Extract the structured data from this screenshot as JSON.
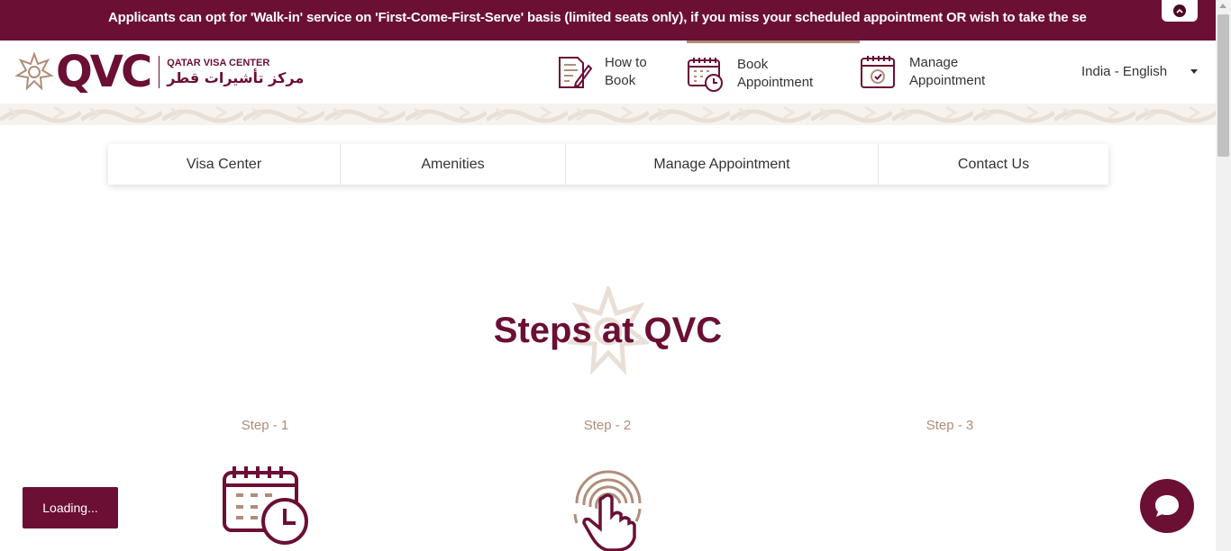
{
  "announcement": {
    "text": "Applicants can opt for 'Walk-in' service on 'First-Come-First-Serve' basis (limited seats only), if you miss your scheduled appointment OR wish to take the se"
  },
  "logo": {
    "mark": "QVC",
    "subtitle_en": "QATAR VISA CENTER",
    "subtitle_ar": "مركز تأشيرات قطر"
  },
  "top_nav": {
    "how_to_book": {
      "line1": "How to",
      "line2": "Book",
      "icon": "document-pen-icon"
    },
    "book_appointment": {
      "line1": "Book",
      "line2": "Appointment",
      "icon": "calendar-clock-icon"
    },
    "manage_appointment": {
      "line1": "Manage",
      "line2": "Appointment",
      "icon": "calendar-check-icon"
    }
  },
  "language": {
    "selected": "India - English"
  },
  "sub_nav": {
    "items": [
      "Visa Center",
      "Amenities",
      "Manage Appointment",
      "Contact Us"
    ]
  },
  "steps": {
    "title": "Steps at QVC",
    "items": [
      {
        "label": "Step - 1",
        "icon": "calendar-clock-icon"
      },
      {
        "label": "Step - 2",
        "icon": "fingerprint-tap-icon"
      },
      {
        "label": "Step - 3"
      }
    ]
  },
  "loading": {
    "text": "Loading..."
  },
  "chat": {
    "icon": "chat-bubble-icon"
  },
  "colors": {
    "brand": "#6b0f35",
    "accent": "#b08d7a",
    "white": "#ffffff"
  }
}
